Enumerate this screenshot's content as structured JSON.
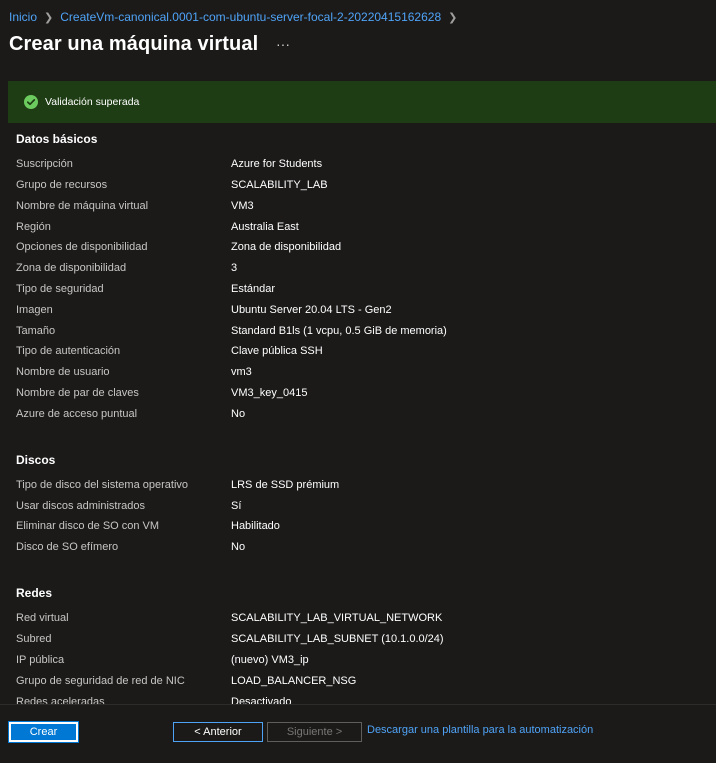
{
  "breadcrumb": [
    {
      "label": "Inicio"
    },
    {
      "label": "CreateVm-canonical.0001-com-ubuntu-server-focal-2-20220415162628"
    }
  ],
  "page": {
    "title": "Crear una máquina virtual",
    "more": "···"
  },
  "banner": {
    "text": "Validación superada",
    "color": "#1e3d14",
    "icon": "check-circle-icon"
  },
  "sections": {
    "basics": {
      "title": "Datos básicos",
      "rows": [
        {
          "label": "Suscripción",
          "value": "Azure for Students"
        },
        {
          "label": "Grupo de recursos",
          "value": "SCALABILITY_LAB"
        },
        {
          "label": "Nombre de máquina virtual",
          "value": "VM3"
        },
        {
          "label": "Región",
          "value": "Australia East"
        },
        {
          "label": "Opciones de disponibilidad",
          "value": "Zona de disponibilidad"
        },
        {
          "label": "Zona de disponibilidad",
          "value": "3"
        },
        {
          "label": "Tipo de seguridad",
          "value": "Estándar"
        },
        {
          "label": "Imagen",
          "value": "Ubuntu Server 20.04 LTS - Gen2"
        },
        {
          "label": "Tamaño",
          "value": "Standard B1ls (1 vcpu, 0.5 GiB de memoria)"
        },
        {
          "label": "Tipo de autenticación",
          "value": "Clave pública SSH"
        },
        {
          "label": "Nombre de usuario",
          "value": "vm3"
        },
        {
          "label": "Nombre de par de claves",
          "value": "VM3_key_0415"
        },
        {
          "label": "Azure de acceso puntual",
          "value": "No"
        }
      ]
    },
    "disks": {
      "title": "Discos",
      "rows": [
        {
          "label": "Tipo de disco del sistema operativo",
          "value": "LRS de SSD prémium"
        },
        {
          "label": "Usar discos administrados",
          "value": "Sí"
        },
        {
          "label": "Eliminar disco de SO con VM",
          "value": "Habilitado"
        },
        {
          "label": "Disco de SO efímero",
          "value": "No"
        }
      ]
    },
    "network": {
      "title": "Redes",
      "rows": [
        {
          "label": "Red virtual",
          "value": "SCALABILITY_LAB_VIRTUAL_NETWORK"
        },
        {
          "label": "Subred",
          "value": "SCALABILITY_LAB_SUBNET (10.1.0.0/24)"
        },
        {
          "label": "IP pública",
          "value": "(nuevo) VM3_ip"
        },
        {
          "label": "Grupo de seguridad de red de NIC",
          "value": "LOAD_BALANCER_NSG"
        },
        {
          "label": "Redes aceleradas",
          "value": "Desactivado"
        }
      ]
    }
  },
  "footer": {
    "create": "Crear",
    "previous": "< Anterior",
    "next": "Siguiente >",
    "download_link": "Descargar una plantilla para la automatización"
  }
}
